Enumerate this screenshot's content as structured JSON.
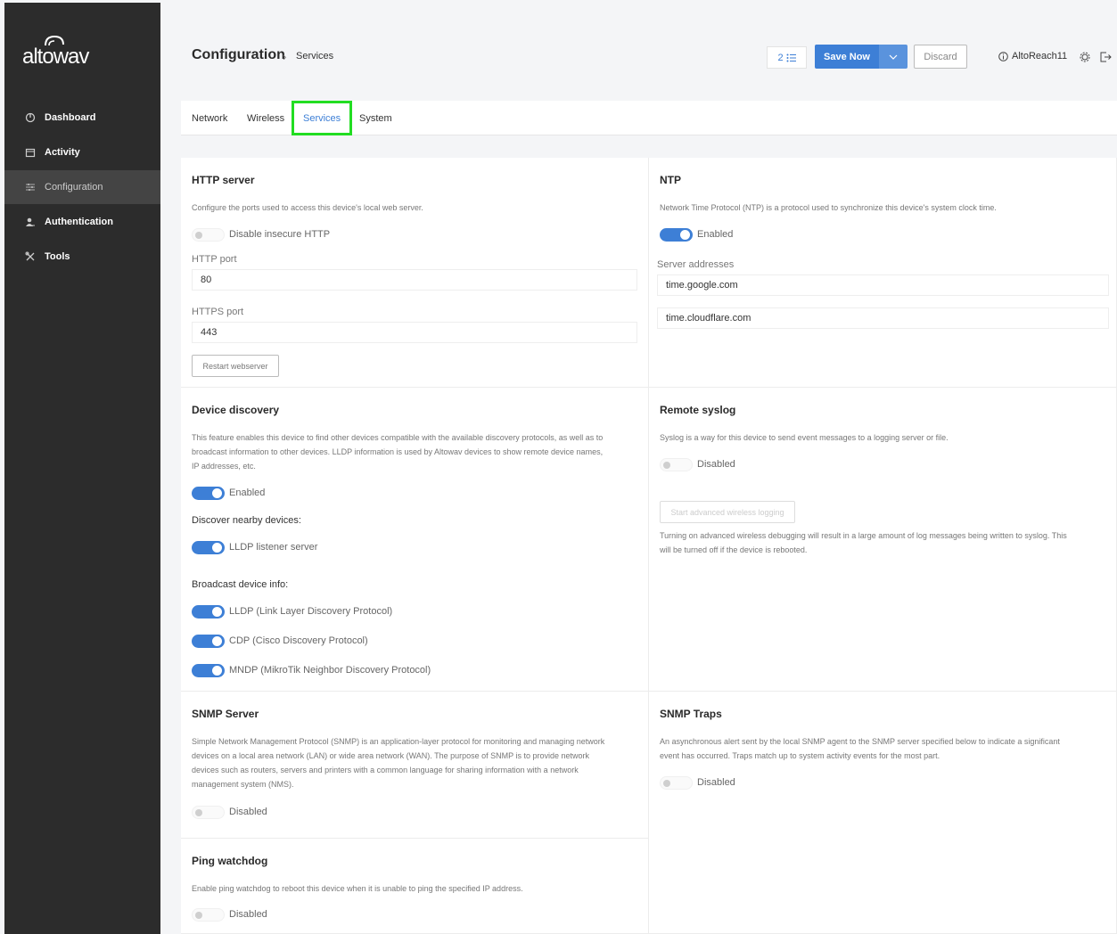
{
  "sidebar": {
    "logo_text": "altowav",
    "items": [
      {
        "label": "Dashboard",
        "icon": "dashboard-icon"
      },
      {
        "label": "Activity",
        "icon": "calendar-icon"
      },
      {
        "label": "Configuration",
        "icon": "sliders-icon"
      },
      {
        "label": "Authentication",
        "icon": "users-icon"
      },
      {
        "label": "Tools",
        "icon": "tools-icon"
      }
    ]
  },
  "header": {
    "title": "Configuration",
    "breadcrumb_sep": "›",
    "breadcrumb": "Services",
    "queue_count": "2",
    "save_label": "Save Now",
    "discard_label": "Discard",
    "device_name": "AltoReach11"
  },
  "tabs": [
    {
      "label": "Network"
    },
    {
      "label": "Wireless"
    },
    {
      "label": "Services"
    },
    {
      "label": "System"
    }
  ],
  "http": {
    "title": "HTTP server",
    "desc": "Configure the ports used to access this device's local web server.",
    "toggle_label": "Disable insecure HTTP",
    "http_port_label": "HTTP port",
    "http_port": "80",
    "https_port_label": "HTTPS port",
    "https_port": "443",
    "restart_label": "Restart webserver"
  },
  "ntp": {
    "title": "NTP",
    "desc": "Network Time Protocol (NTP) is a protocol used to synchronize this device's system clock time.",
    "toggle_label": "Enabled",
    "servers_label": "Server addresses",
    "servers": [
      "time.google.com",
      "time.cloudflare.com"
    ]
  },
  "discovery": {
    "title": "Device discovery",
    "desc_lines": [
      "This feature enables this device to find other devices compatible with the available discovery protocols, as well as to",
      "broadcast information to other devices. LLDP information is used by Altowav devices to show remote device names,",
      "IP addresses, etc."
    ],
    "toggle_label": "Enabled",
    "discover_label": "Discover nearby devices:",
    "lldp_listener": "LLDP listener server",
    "broadcast_label": "Broadcast device info:",
    "lldp": "LLDP (Link Layer Discovery Protocol)",
    "cdp": "CDP (Cisco Discovery Protocol)",
    "mndp": "MNDP (MikroTik Neighbor Discovery Protocol)"
  },
  "syslog": {
    "title": "Remote syslog",
    "desc": "Syslog is a way for this device to send event messages to a logging server or file.",
    "toggle_label": "Disabled",
    "logging_btn": "Start advanced wireless logging",
    "note_lines": [
      "Turning on advanced wireless debugging will result in a large amount of log messages being written to syslog. This",
      "will be turned off if the device is rebooted."
    ]
  },
  "snmp_server": {
    "title": "SNMP Server",
    "desc_lines": [
      "Simple Network Management Protocol (SNMP) is an application-layer protocol for monitoring and managing network",
      "devices on a local area network (LAN) or wide area network (WAN). The purpose of SNMP is to provide network",
      "devices such as routers, servers and printers with a common language for sharing information with a network",
      "management system (NMS)."
    ],
    "toggle_label": "Disabled"
  },
  "snmp_traps": {
    "title": "SNMP Traps",
    "desc_lines": [
      "An asynchronous alert sent by the local SNMP agent to the SNMP server specified below to indicate a significant",
      "event has occurred. Traps match up to system activity events for the most part."
    ],
    "toggle_label": "Disabled"
  },
  "ping": {
    "title": "Ping watchdog",
    "desc": "Enable ping watchdog to reboot this device when it is unable to ping the specified IP address.",
    "toggle_label": "Disabled"
  }
}
